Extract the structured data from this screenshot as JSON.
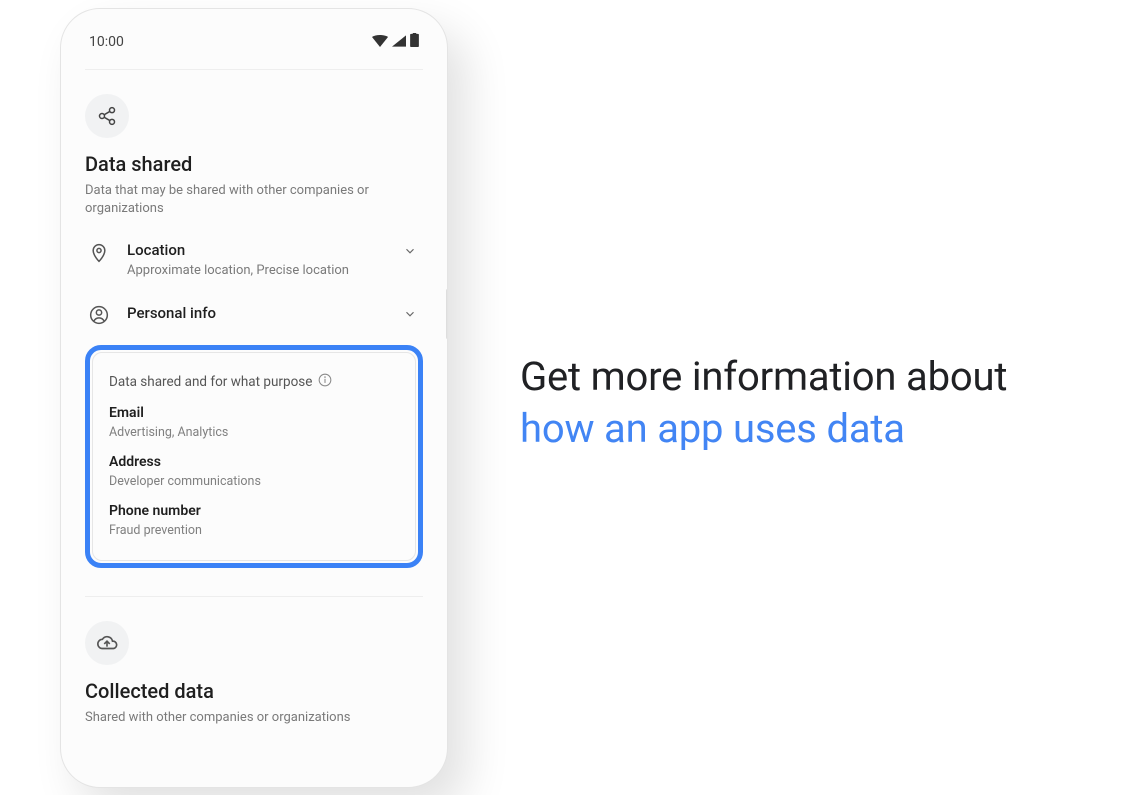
{
  "status": {
    "time": "10:00"
  },
  "shared": {
    "title": "Data shared",
    "subtitle": "Data that may be shared with other companies or organizations"
  },
  "rows": {
    "location": {
      "title": "Location",
      "sub": "Approximate location, Precise location"
    },
    "personal": {
      "title": "Personal info"
    }
  },
  "highlight": {
    "heading": "Data shared and for what purpose",
    "items": [
      {
        "title": "Email",
        "sub": "Advertising, Analytics"
      },
      {
        "title": "Address",
        "sub": "Developer communications"
      },
      {
        "title": "Phone number",
        "sub": "Fraud prevention"
      }
    ]
  },
  "collected": {
    "title": "Collected data",
    "subtitle": "Shared with other companies or organizations"
  },
  "headline": {
    "line1": "Get more information about",
    "line2": "how an app uses data"
  },
  "colors": {
    "accent": "#4285f4",
    "highlight_border": "#3b82f6"
  }
}
